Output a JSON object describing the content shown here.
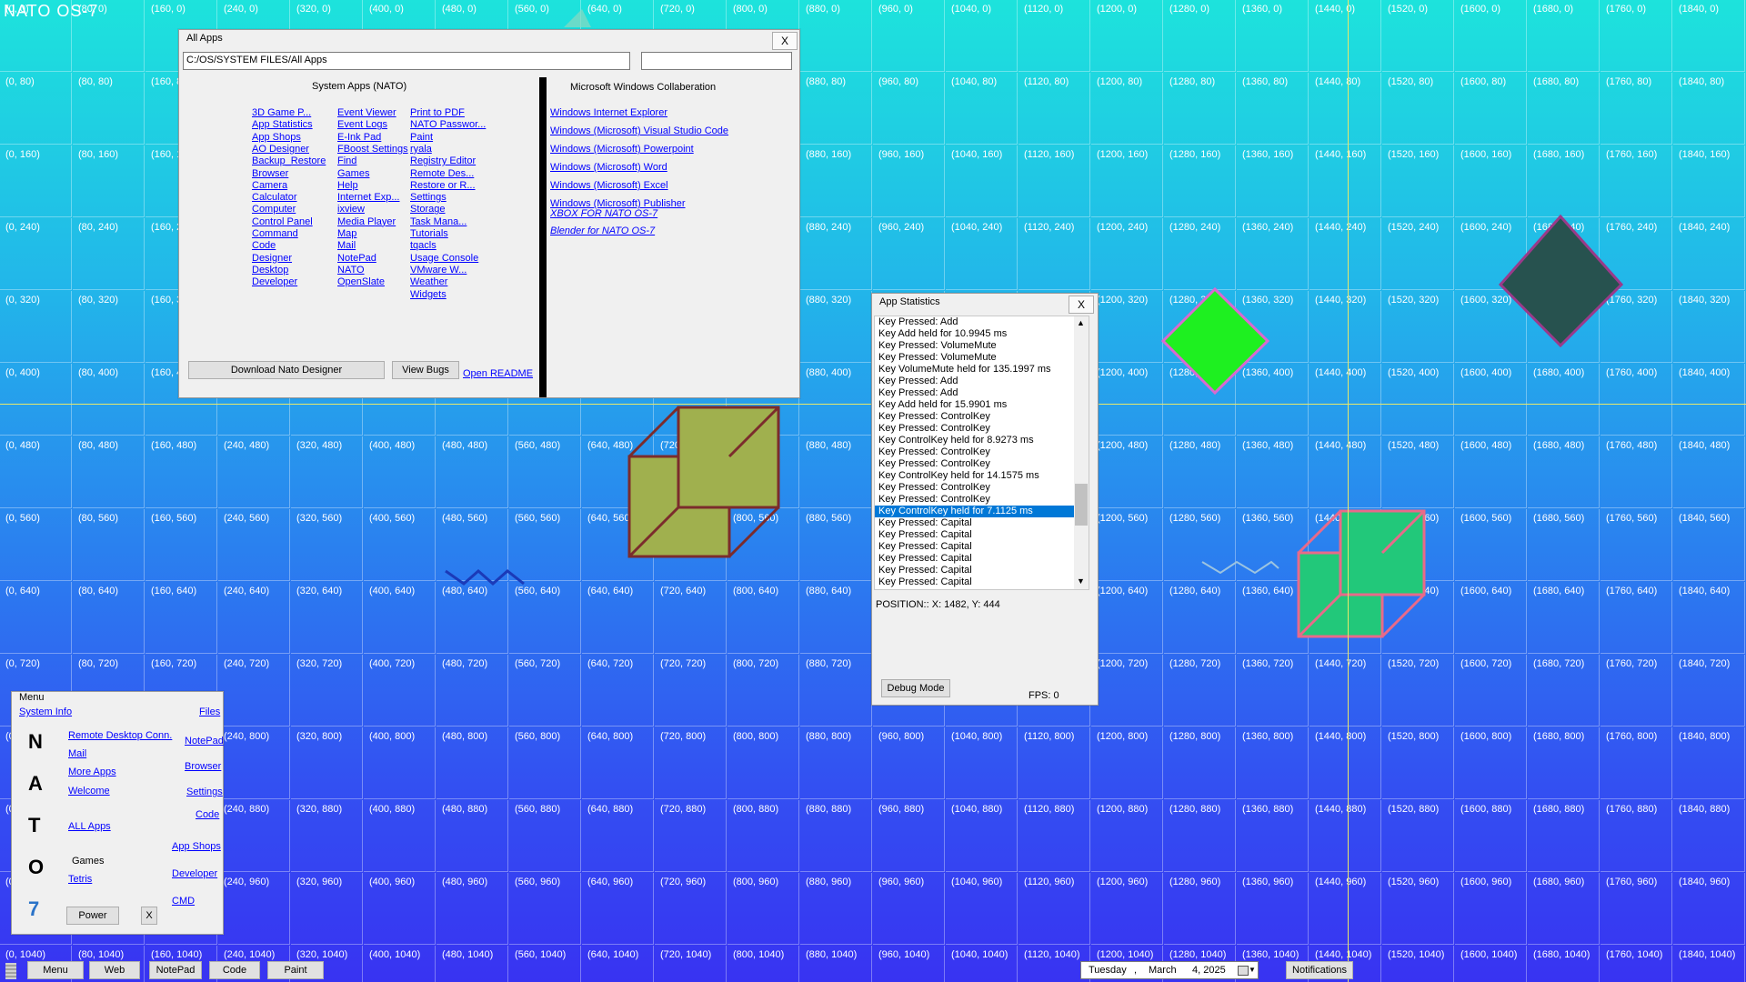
{
  "os_title": "NATO OS-7",
  "grid": {
    "cols": [
      0,
      80,
      160,
      240,
      320,
      400,
      480,
      560,
      640,
      720,
      800,
      880,
      960,
      1040,
      1120,
      1200,
      1280,
      1360,
      1440,
      1520,
      1600,
      1680,
      1760,
      1840
    ],
    "rows": [
      0,
      80,
      160,
      240,
      320,
      400,
      480,
      560,
      640,
      720,
      800,
      880,
      960,
      1040
    ]
  },
  "all_apps": {
    "title": "All Apps",
    "close": "X",
    "path": "C:/OS/SYSTEM FILES/All Apps",
    "search_value": "",
    "system_heading": "System Apps (NATO)",
    "ms_heading": "Microsoft Windows Collaberation",
    "col1": [
      "3D Game P...",
      "App Statistics",
      "App Shops",
      "AO Designer",
      "Backup_Restore",
      "Browser",
      "Camera",
      "Calculator",
      "Computer",
      "Control Panel",
      "Command",
      "Code",
      "Designer",
      "Desktop",
      "Developer"
    ],
    "col2": [
      "Event Viewer",
      "Event Logs",
      "E-Ink Pad",
      "FBoost Settings",
      "Find",
      "Games",
      "Help",
      "Internet Exp...",
      "ixview",
      "Media Player",
      "Map",
      "Mail",
      "NotePad",
      "NATO",
      "OpenSlate"
    ],
    "col3": [
      "Print to PDF",
      "NATO Passwor...",
      "Paint",
      "ryala",
      "Registry Editor",
      "Remote Des...",
      "Restore or R...",
      "Settings",
      "Storage",
      "Task Mana...",
      "Tutorials",
      "tqacls",
      "Usage Console",
      "VMware W...",
      "Weather",
      "Widgets"
    ],
    "ms_apps": [
      "Windows Internet Explorer",
      "Windows (Microsoft) Visual Studio Code",
      "Windows (Microsoft) Powerpoint",
      "Windows (Microsoft) Word",
      "Windows (Microsoft) Excel",
      "Windows (Microsoft) Publisher"
    ],
    "ms_italic": [
      "XBOX FOR NATO OS-7",
      "Blender for NATO OS-7"
    ],
    "download_btn": "Download Nato Designer",
    "bugs_btn": "View Bugs",
    "readme_link": "Open README"
  },
  "stats": {
    "title": "App Statistics",
    "close": "X",
    "log": [
      "Key Pressed: Add",
      "Key Add held for 10.9945 ms",
      "Key Pressed: VolumeMute",
      "Key Pressed: VolumeMute",
      "Key VolumeMute held for 135.1997 ms",
      "Key Pressed: Add",
      "Key Pressed: Add",
      "Key Add held for 15.9901 ms",
      "Key Pressed: ControlKey",
      "Key Pressed: ControlKey",
      "Key ControlKey held for 8.9273 ms",
      "Key Pressed: ControlKey",
      "Key Pressed: ControlKey",
      "Key ControlKey held for 14.1575 ms",
      "Key Pressed: ControlKey",
      "Key Pressed: ControlKey",
      "Key ControlKey held for 7.1125 ms",
      "Key Pressed: Capital",
      "Key Pressed: Capital",
      "Key Pressed: Capital",
      "Key Pressed: Capital",
      "Key Pressed: Capital",
      "Key Pressed: Capital"
    ],
    "selected_index": 16,
    "position": "POSITION:: X: 1482, Y: 444",
    "debug_btn": "Debug Mode",
    "fps": "FPS: 0"
  },
  "menu": {
    "title": "Menu",
    "system_info": "System Info",
    "files": "Files",
    "left_links": [
      "Remote Desktop Conn.",
      "Mail",
      "More Apps",
      "Welcome",
      "ALL Apps",
      "Games",
      "Tetris"
    ],
    "right_links": [
      "NotePad",
      "Browser",
      "Settings",
      "Code",
      "App Shops",
      "Developer",
      "CMD"
    ],
    "letters": [
      "N",
      "A",
      "T",
      "O",
      "7"
    ],
    "power": "Power",
    "close": "X"
  },
  "taskbar": {
    "buttons": [
      "Menu",
      "Web",
      "NotePad",
      "Code",
      "Paint"
    ],
    "date_day": "Tuesday",
    "date_month": "March",
    "date_num": "4, 2025",
    "notifications": "Notifications"
  }
}
